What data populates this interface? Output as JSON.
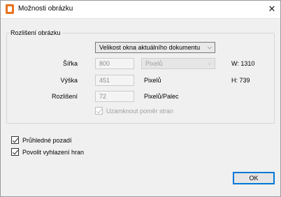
{
  "window": {
    "title": "Možnosti obrázku",
    "close_glyph": "✕"
  },
  "resolution_group": {
    "legend": "Rozlišení obrázku",
    "size_preset": {
      "value": "Velikost okna aktuálního dokumentu",
      "arrow": "⌵"
    },
    "width": {
      "label": "Šířka",
      "value": "800",
      "unit_value": "Pixelů",
      "arrow": "⌵",
      "info": "W: 1310"
    },
    "height": {
      "label": "Výška",
      "value": "451",
      "unit": "Pixelů",
      "info": "H: 739"
    },
    "resolution": {
      "label": "Rozlišení",
      "value": "72",
      "unit": "Pixelů/Palec"
    },
    "lock_ratio": {
      "label": "Uzamknout poměr stran",
      "checked": true,
      "disabled": true
    }
  },
  "options": {
    "transparent_bg": {
      "label": "Průhledné pozadí",
      "checked": true
    },
    "antialias": {
      "label": "Povolit vyhlazení hran",
      "checked": true
    }
  },
  "buttons": {
    "ok": "OK"
  }
}
